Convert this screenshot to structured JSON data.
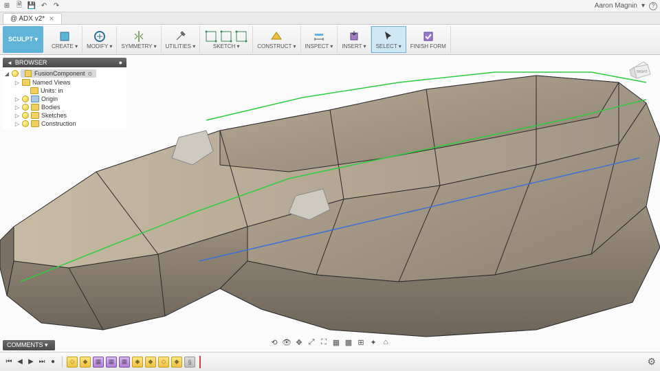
{
  "qat": {
    "icons": [
      "grid",
      "file",
      "save",
      "undo",
      "redo"
    ],
    "user": "Aaron Magnin",
    "help_icon": "help"
  },
  "tab": {
    "title": "@ ADX v2*"
  },
  "ribbon": {
    "mode": "SCULPT ▾",
    "groups": [
      {
        "label": "CREATE ▾",
        "icon": "create"
      },
      {
        "label": "MODIFY ▾",
        "icon": "modify"
      },
      {
        "label": "SYMMETRY ▾",
        "icon": "symmetry"
      },
      {
        "label": "UTILITIES ▾",
        "icon": "utilities"
      },
      {
        "label": "SKETCH ▾",
        "icon": "sketch",
        "multi": true
      },
      {
        "label": "CONSTRUCT ▾",
        "icon": "construct"
      },
      {
        "label": "INSPECT ▾",
        "icon": "inspect"
      },
      {
        "label": "INSERT ▾",
        "icon": "insert"
      },
      {
        "label": "SELECT ▾",
        "icon": "select",
        "selected": true
      },
      {
        "label": "FINISH FORM",
        "icon": "finish"
      }
    ]
  },
  "browser": {
    "title": "BROWSER",
    "pin_icon": "●",
    "root": "FusionComponent",
    "items": [
      {
        "label": "Named Views",
        "indent": 1,
        "toggle": "▷",
        "folder": "plain"
      },
      {
        "label": "Units: in",
        "indent": 2,
        "toggle": "",
        "folder": "plain"
      },
      {
        "label": "Origin",
        "indent": 1,
        "toggle": "▷",
        "bulb": true,
        "folder": "blue"
      },
      {
        "label": "Bodies",
        "indent": 1,
        "toggle": "▷",
        "bulb": true,
        "folder": "plain"
      },
      {
        "label": "Sketches",
        "indent": 1,
        "toggle": "▷",
        "bulb": true,
        "folder": "plain"
      },
      {
        "label": "Construction",
        "indent": 1,
        "toggle": "▷",
        "bulb": true,
        "folder": "yellow"
      }
    ]
  },
  "viewcube": {
    "face": "RIGHT"
  },
  "comments": {
    "title": "COMMENTS ▾"
  },
  "navbar": {
    "icons": [
      "orbit",
      "look",
      "pan",
      "zoom",
      "fit",
      "display",
      "grid",
      "snap",
      "effects",
      "camera"
    ]
  },
  "timeline": {
    "controls": [
      "⏮",
      "◀",
      "▶",
      "⏭",
      "●"
    ],
    "features": [
      {
        "type": "yellow",
        "glyph": "◇"
      },
      {
        "type": "yellow",
        "glyph": "◆"
      },
      {
        "type": "purple",
        "glyph": "▦"
      },
      {
        "type": "purple",
        "glyph": "▦"
      },
      {
        "type": "purple",
        "glyph": "▦"
      },
      {
        "type": "yellow",
        "glyph": "◆"
      },
      {
        "type": "yellow",
        "glyph": "◆"
      },
      {
        "type": "yellow",
        "glyph": "◇"
      },
      {
        "type": "yellow",
        "glyph": "◆"
      },
      {
        "type": "gray",
        "glyph": "§"
      }
    ],
    "gear": "⚙"
  }
}
